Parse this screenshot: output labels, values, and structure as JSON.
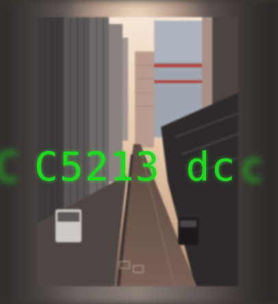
{
  "overlay": {
    "caption": "C5213 dc",
    "ghost_left": "C",
    "ghost_right": "c",
    "color": "#23d623"
  },
  "scene": {
    "description_tags": [
      "city-street",
      "skyscrapers",
      "sunset-haze"
    ]
  }
}
